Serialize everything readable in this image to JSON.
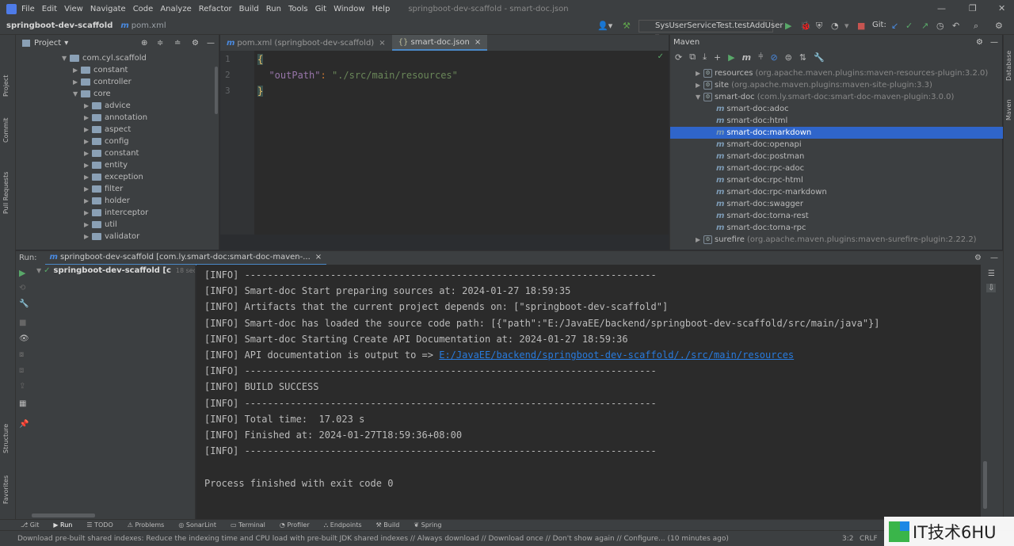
{
  "menu": [
    "File",
    "Edit",
    "View",
    "Navigate",
    "Code",
    "Analyze",
    "Refactor",
    "Build",
    "Run",
    "Tools",
    "Git",
    "Window",
    "Help"
  ],
  "window_title": "springboot-dev-scaffold - smart-doc.json",
  "nav": {
    "project": "springboot-dev-scaffold",
    "file": "pom.xml",
    "run_config": "SysUserServiceTest.testAddUser",
    "git_label": "Git:"
  },
  "left_stripe": [
    "Project",
    "Commit",
    "Pull Requests",
    "Structure",
    "Favorites"
  ],
  "project": {
    "header": "Project",
    "tree": [
      {
        "label": "com.cyl.scaffold",
        "depth": 0,
        "open": true
      },
      {
        "label": "constant",
        "depth": 1,
        "open": false
      },
      {
        "label": "controller",
        "depth": 1,
        "open": false
      },
      {
        "label": "core",
        "depth": 1,
        "open": true
      },
      {
        "label": "advice",
        "depth": 2,
        "open": false
      },
      {
        "label": "annotation",
        "depth": 2,
        "open": false
      },
      {
        "label": "aspect",
        "depth": 2,
        "open": false
      },
      {
        "label": "config",
        "depth": 2,
        "open": false
      },
      {
        "label": "constant",
        "depth": 2,
        "open": false
      },
      {
        "label": "entity",
        "depth": 2,
        "open": false
      },
      {
        "label": "exception",
        "depth": 2,
        "open": false
      },
      {
        "label": "filter",
        "depth": 2,
        "open": false
      },
      {
        "label": "holder",
        "depth": 2,
        "open": false
      },
      {
        "label": "interceptor",
        "depth": 2,
        "open": false
      },
      {
        "label": "util",
        "depth": 2,
        "open": false
      },
      {
        "label": "validator",
        "depth": 2,
        "open": false
      }
    ]
  },
  "editor": {
    "tabs": [
      {
        "label": "pom.xml (springboot-dev-scaffold)"
      },
      {
        "label": "smart-doc.json"
      }
    ],
    "lines": [
      {
        "n": "1",
        "text": "{"
      },
      {
        "n": "2",
        "text": "  \"outPath\": \"./src/main/resources\""
      },
      {
        "n": "3",
        "text": "}"
      }
    ]
  },
  "maven": {
    "header": "Maven",
    "items": [
      {
        "name": "resources",
        "gav": "(org.apache.maven.plugins:maven-resources-plugin:3.2.0)",
        "depth": 0,
        "goal": false
      },
      {
        "name": "site",
        "gav": "(org.apache.maven.plugins:maven-site-plugin:3.3)",
        "depth": 0,
        "goal": false
      },
      {
        "name": "smart-doc",
        "gav": "(com.ly.smart-doc:smart-doc-maven-plugin:3.0.0)",
        "depth": 0,
        "goal": false,
        "open": true
      },
      {
        "name": "smart-doc:adoc",
        "gav": "",
        "depth": 1,
        "goal": true
      },
      {
        "name": "smart-doc:html",
        "gav": "",
        "depth": 1,
        "goal": true
      },
      {
        "name": "smart-doc:markdown",
        "gav": "",
        "depth": 1,
        "goal": true,
        "selected": true
      },
      {
        "name": "smart-doc:openapi",
        "gav": "",
        "depth": 1,
        "goal": true
      },
      {
        "name": "smart-doc:postman",
        "gav": "",
        "depth": 1,
        "goal": true
      },
      {
        "name": "smart-doc:rpc-adoc",
        "gav": "",
        "depth": 1,
        "goal": true
      },
      {
        "name": "smart-doc:rpc-html",
        "gav": "",
        "depth": 1,
        "goal": true
      },
      {
        "name": "smart-doc:rpc-markdown",
        "gav": "",
        "depth": 1,
        "goal": true
      },
      {
        "name": "smart-doc:swagger",
        "gav": "",
        "depth": 1,
        "goal": true
      },
      {
        "name": "smart-doc:torna-rest",
        "gav": "",
        "depth": 1,
        "goal": true
      },
      {
        "name": "smart-doc:torna-rpc",
        "gav": "",
        "depth": 1,
        "goal": true
      },
      {
        "name": "surefire",
        "gav": "(org.apache.maven.plugins:maven-surefire-plugin:2.22.2)",
        "depth": 0,
        "goal": false
      }
    ]
  },
  "right_stripe": [
    "Database",
    "Maven"
  ],
  "run": {
    "label": "Run:",
    "tab": "springboot-dev-scaffold [com.ly.smart-doc:smart-doc-maven-...",
    "tree_item": "springboot-dev-scaffold [c",
    "tree_time": "18 sec, 88 ms",
    "console": [
      {
        "text": "[INFO] ------------------------------------------------------------------------"
      },
      {
        "text": "[INFO] Smart-doc Start preparing sources at: 2024-01-27 18:59:35"
      },
      {
        "text": "[INFO] Artifacts that the current project depends on: [\"springboot-dev-scaffold\"]"
      },
      {
        "text": "[INFO] Smart-doc has loaded the source code path: [{\"path\":\"E:/JavaEE/backend/springboot-dev-scaffold/src/main/java\"}]"
      },
      {
        "text": "[INFO] Smart-doc Starting Create API Documentation at: 2024-01-27 18:59:36"
      },
      {
        "text": "[INFO] API documentation is output to => ",
        "link": "E:/JavaEE/backend/springboot-dev-scaffold/./src/main/resources"
      },
      {
        "text": "[INFO] ------------------------------------------------------------------------"
      },
      {
        "text": "[INFO] BUILD SUCCESS"
      },
      {
        "text": "[INFO] ------------------------------------------------------------------------"
      },
      {
        "text": "[INFO] Total time:  17.023 s"
      },
      {
        "text": "[INFO] Finished at: 2024-01-27T18:59:36+08:00"
      },
      {
        "text": "[INFO] ------------------------------------------------------------------------"
      },
      {
        "text": ""
      },
      {
        "text": "Process finished with exit code 0"
      }
    ]
  },
  "tool_windows": [
    "Git",
    "Run",
    "TODO",
    "Problems",
    "SonarLint",
    "Terminal",
    "Profiler",
    "Endpoints",
    "Build",
    "Spring"
  ],
  "status": {
    "message": "Download pre-built shared indexes: Reduce the indexing time and CPU load with pre-built JDK shared indexes // Always download // Download once // Don't show again // Configure... (10 minutes ago)",
    "position": "3:2",
    "line_sep": "CRLF"
  },
  "watermark": "IT技术6HU",
  "colors": {
    "selection": "#2f65ca",
    "link": "#287bde",
    "accent": "#4a88c7",
    "editor_bg": "#2b2b2b",
    "panel_bg": "#3c3f41"
  }
}
